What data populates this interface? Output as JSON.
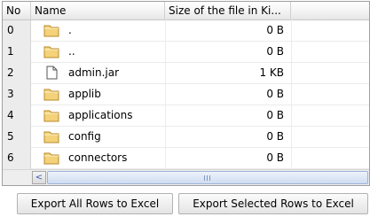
{
  "columns": {
    "no": "No",
    "name": "Name",
    "size": "Size of the file in Ki..."
  },
  "rows": [
    {
      "no": "0",
      "icon": "folder-icon",
      "name": ".",
      "size": "0 B"
    },
    {
      "no": "1",
      "icon": "folder-icon",
      "name": "..",
      "size": "0 B"
    },
    {
      "no": "2",
      "icon": "file-icon",
      "name": "admin.jar",
      "size": "1 KB"
    },
    {
      "no": "3",
      "icon": "folder-icon",
      "name": "applib",
      "size": "0 B"
    },
    {
      "no": "4",
      "icon": "folder-icon",
      "name": "applications",
      "size": "0 B"
    },
    {
      "no": "5",
      "icon": "folder-icon",
      "name": "config",
      "size": "0 B"
    },
    {
      "no": "6",
      "icon": "folder-icon",
      "name": "connectors",
      "size": "0 B"
    }
  ],
  "scrollbar": {
    "left_arrow": "<"
  },
  "buttons": {
    "export_all": "Export All Rows to Excel",
    "export_selected": "Export Selected Rows to Excel"
  },
  "colors": {
    "folder": "#f3d27a",
    "folder_edge": "#b8892a"
  }
}
